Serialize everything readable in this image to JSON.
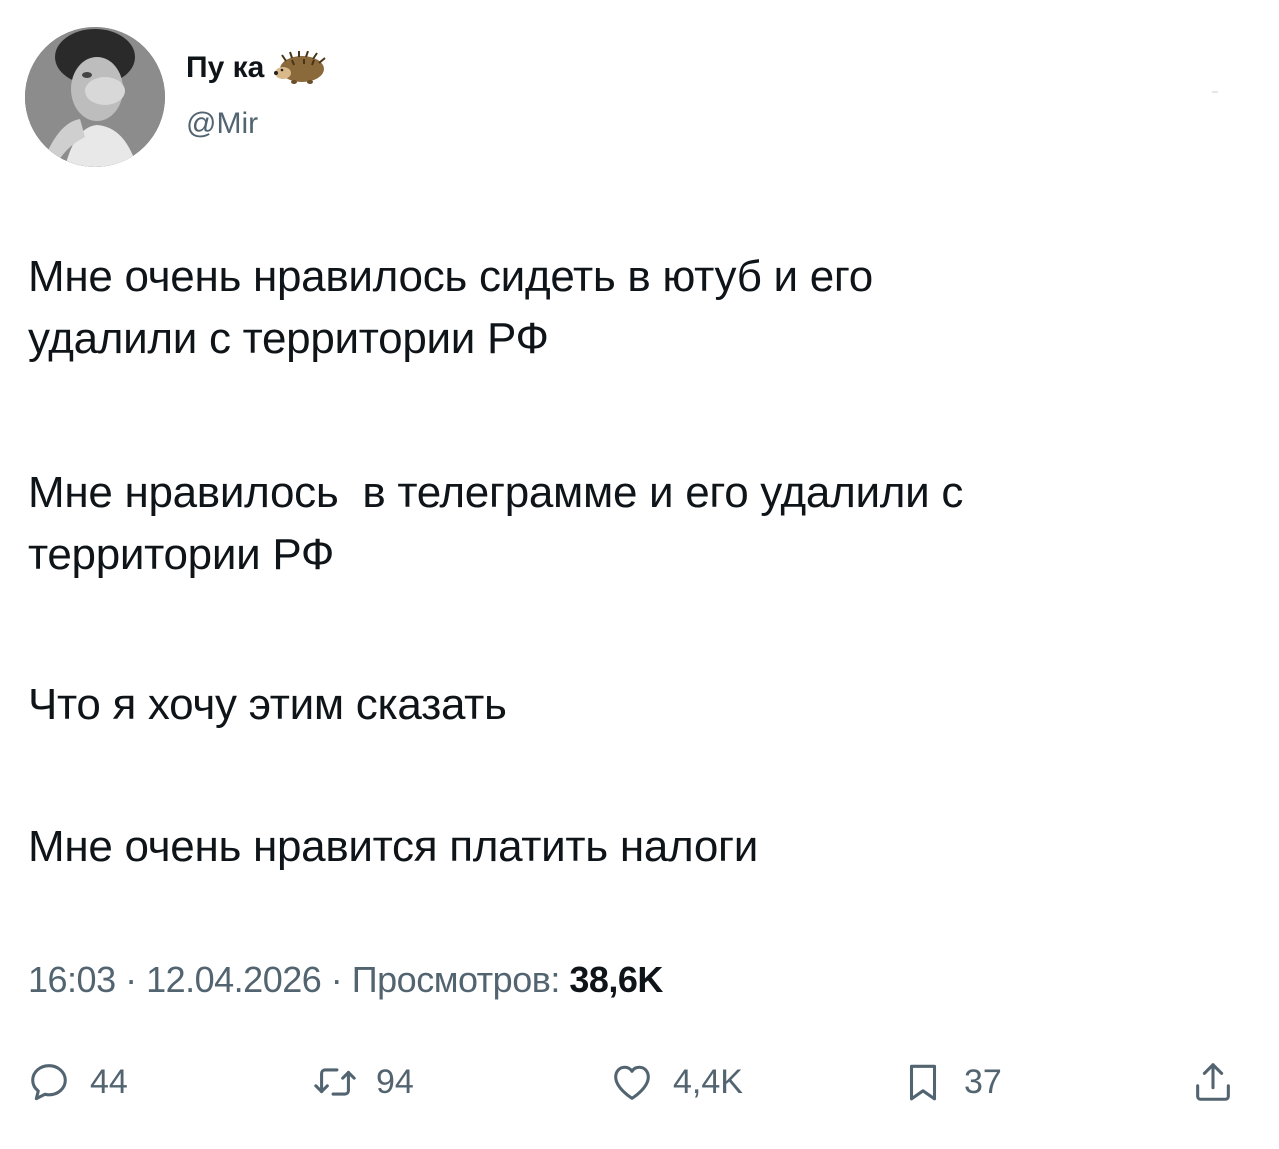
{
  "author": {
    "display_name": "Пу ка",
    "handle": "@Mir",
    "emoji_icon": "hedgehog-icon"
  },
  "tweet": {
    "paragraphs": [
      [
        "Мне очень нравилось сидеть в ютуб и его",
        "удалили с территории РФ"
      ],
      [
        "Мне нравилось  в телеграмме и его удалили с",
        "территории РФ"
      ],
      [
        "Что я хочу этим сказать"
      ],
      [
        "Мне очень нравится платить налоги"
      ]
    ]
  },
  "meta": {
    "time": "16:03",
    "separator": " · ",
    "date": "12.04.2026",
    "views_label": "Просмотров:",
    "views_count": "38,6K"
  },
  "actions": {
    "reply": {
      "icon": "comment-icon",
      "count": "44"
    },
    "retweet": {
      "icon": "retweet-icon",
      "count": "94"
    },
    "like": {
      "icon": "heart-icon",
      "count": "4,4K"
    },
    "bookmark": {
      "icon": "bookmark-icon",
      "count": "37"
    },
    "share": {
      "icon": "share-icon"
    }
  },
  "colors": {
    "text_primary": "#0f1419",
    "text_secondary": "#536471",
    "background": "#ffffff"
  }
}
